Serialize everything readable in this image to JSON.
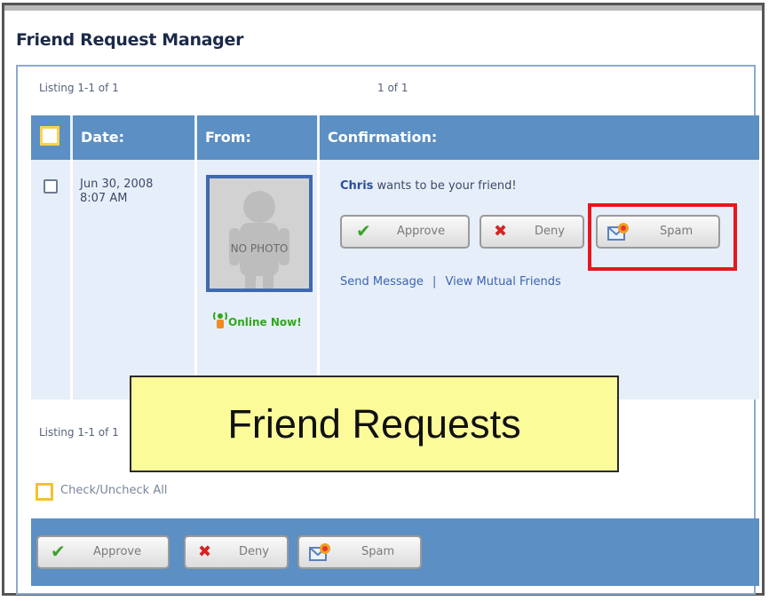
{
  "title": "Friend Request Manager",
  "listing_top": "Listing 1-1 of 1",
  "pager": "1   of 1",
  "listing_bottom": "Listing 1-1 of 1",
  "columns": {
    "date": "Date:",
    "from": "From:",
    "confirmation": "Confirmation:"
  },
  "request": {
    "date_line1": "Jun 30, 2008",
    "date_line2": "8:07 AM",
    "photo_text": "NO PHOTO",
    "online_status": "Online Now!",
    "name": "Chris",
    "message": " wants to be your friend!",
    "approve_label": "Approve",
    "deny_label": "Deny",
    "spam_label": "Spam",
    "send_message": "Send Message",
    "link_separator": "|",
    "view_mutual": "View Mutual Friends"
  },
  "callout_text": "Friend Requests",
  "check_all_label": "Check/Uncheck All",
  "footer": {
    "approve_label": "Approve",
    "deny_label": "Deny",
    "spam_label": "Spam"
  },
  "colors": {
    "header_blue": "#5c8fc3",
    "row_bg": "#e6eef9",
    "highlight_red": "#e8161c",
    "callout_yellow": "#fbfb9a"
  }
}
